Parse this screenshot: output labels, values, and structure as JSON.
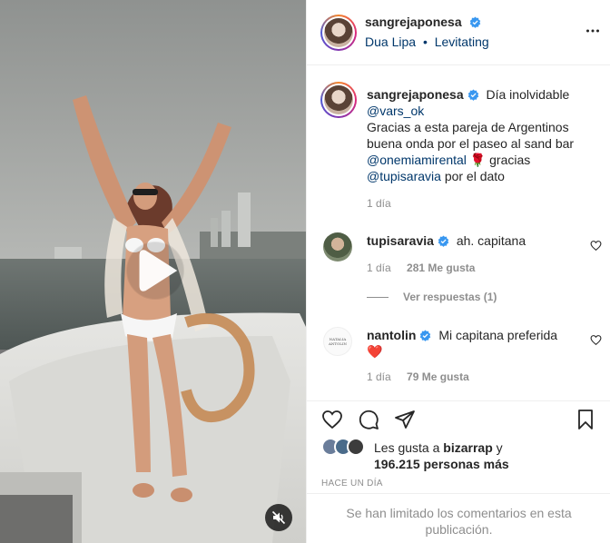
{
  "media": {
    "type": "video",
    "play_icon": "play-icon",
    "mute_icon": "speaker-muted-icon"
  },
  "header": {
    "username": "sangrejaponesa",
    "verified": true,
    "artist": "Dua Lipa",
    "separator": "•",
    "song": "Levitating",
    "more_icon": "more-horizontal-icon"
  },
  "caption": {
    "username": "sangrejaponesa",
    "line1": "Día inolvidable",
    "mention1": "@vars_ok",
    "line2": "Gracias a esta pareja de Argentinos buena onda por el paseo al sand bar",
    "mention2": "@onemiamirental",
    "emoji": "🌹",
    "line3": "gracias",
    "mention3": "@tupisaravia",
    "line4": "por el dato",
    "time": "1 día"
  },
  "comments": [
    {
      "username": "tupisaravia",
      "verified": true,
      "text": "ah. capitana",
      "time": "1 día",
      "likes": "281 Me gusta",
      "replies": "Ver respuestas (1)"
    },
    {
      "username": "nantolin",
      "verified": true,
      "text": "Mi capitana preferida",
      "emoji": "❤️",
      "time": "1 día",
      "likes": "79 Me gusta",
      "avatar_text": "NATALIA ANTOLIN"
    }
  ],
  "actions": {
    "like_icon": "heart-icon",
    "comment_icon": "comment-icon",
    "share_icon": "send-icon",
    "save_icon": "bookmark-icon"
  },
  "likes": {
    "prefix": "Les gusta a",
    "user": "bizarrap",
    "conj": "y",
    "count": "196.215 personas más"
  },
  "time_ago": "HACE UN DÍA",
  "limited_notice": "Se han limitado los comentarios en esta publicación.",
  "colors": {
    "verified": "#3897f0",
    "link": "#00376b",
    "muted": "#8e8e8e",
    "heart_red": "#ed4956"
  }
}
